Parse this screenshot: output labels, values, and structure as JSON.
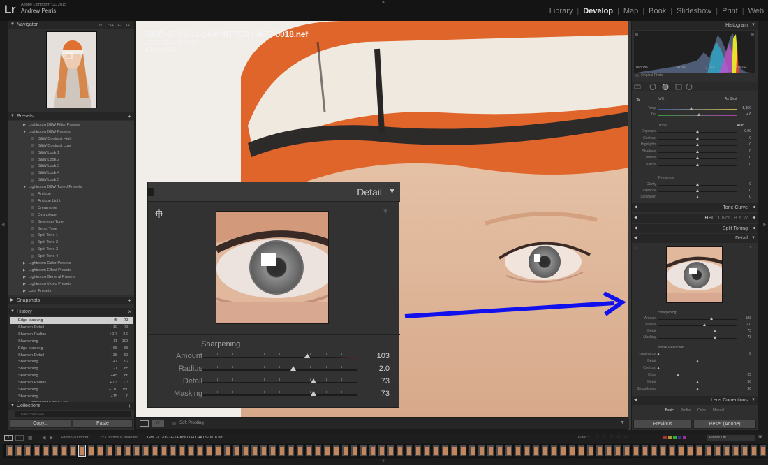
{
  "app": {
    "product": "Adobe Lightroom CC 2015",
    "user": "Andrew Perris",
    "logo": "Lr"
  },
  "modules": [
    {
      "label": "Library",
      "active": false
    },
    {
      "label": "Develop",
      "active": true
    },
    {
      "label": "Map",
      "active": false
    },
    {
      "label": "Book",
      "active": false
    },
    {
      "label": "Slideshow",
      "active": false
    },
    {
      "label": "Print",
      "active": false
    },
    {
      "label": "Web",
      "active": false
    }
  ],
  "navigator": {
    "title": "Navigator",
    "zoom_options": [
      "FIT",
      "FILL",
      "1:1",
      "3:1"
    ]
  },
  "presets": {
    "title": "Presets",
    "items": [
      {
        "label": "Lightroom B&W Filter Presets",
        "level": 1,
        "expanded": false
      },
      {
        "label": "Lightroom B&W Presets",
        "level": 1,
        "expanded": true
      },
      {
        "label": "B&W Contrast High",
        "level": 2
      },
      {
        "label": "B&W Contrast Low",
        "level": 2
      },
      {
        "label": "B&W Look 1",
        "level": 2
      },
      {
        "label": "B&W Look 2",
        "level": 2
      },
      {
        "label": "B&W Look 3",
        "level": 2
      },
      {
        "label": "B&W Look 4",
        "level": 2
      },
      {
        "label": "B&W Look 5",
        "level": 2
      },
      {
        "label": "Lightroom B&W Toned Presets",
        "level": 1,
        "expanded": true
      },
      {
        "label": "Antique",
        "level": 2
      },
      {
        "label": "Antique Light",
        "level": 2
      },
      {
        "label": "Creamtone",
        "level": 2
      },
      {
        "label": "Cyanotype",
        "level": 2
      },
      {
        "label": "Selenium Tone",
        "level": 2
      },
      {
        "label": "Sepia Tone",
        "level": 2
      },
      {
        "label": "Split Tone 1",
        "level": 2
      },
      {
        "label": "Split Tone 2",
        "level": 2
      },
      {
        "label": "Split Tone 3",
        "level": 2
      },
      {
        "label": "Split Tone 4",
        "level": 2
      },
      {
        "label": "Lightroom Color Presets",
        "level": 1,
        "expanded": false
      },
      {
        "label": "Lightroom Effect Presets",
        "level": 1,
        "expanded": false
      },
      {
        "label": "Lightroom General Presets",
        "level": 1,
        "expanded": false
      },
      {
        "label": "Lightroom Video Presets",
        "level": 1,
        "expanded": false
      },
      {
        "label": "User Presets",
        "level": 1,
        "expanded": false
      }
    ]
  },
  "snapshots": {
    "title": "Snapshots"
  },
  "history": {
    "title": "History",
    "items": [
      {
        "label": "Edge Masking",
        "delta": "+5",
        "value": "73",
        "selected": true
      },
      {
        "label": "Sharpen Detail",
        "delta": "+10",
        "value": "73"
      },
      {
        "label": "Sharpen Radius",
        "delta": "+0.7",
        "value": "2.0"
      },
      {
        "label": "Sharpening",
        "delta": "+11",
        "value": "103"
      },
      {
        "label": "Edge Masking",
        "delta": "+68",
        "value": "68"
      },
      {
        "label": "Sharpen Detail",
        "delta": "+38",
        "value": "63"
      },
      {
        "label": "Sharpening",
        "delta": "+7",
        "value": "92"
      },
      {
        "label": "Sharpening",
        "delta": "-1",
        "value": "85"
      },
      {
        "label": "Sharpening",
        "delta": "+45",
        "value": "86"
      },
      {
        "label": "Sharpen Radius",
        "delta": "+0.3",
        "value": "1.3"
      },
      {
        "label": "Sharpening",
        "delta": "+110",
        "value": "150"
      },
      {
        "label": "Sharpening",
        "delta": "+15",
        "value": "0"
      },
      {
        "label": "Import (27/07/2015 10:34:52)",
        "delta": "",
        "value": ""
      }
    ]
  },
  "collections": {
    "title": "Collections",
    "filter_placeholder": "Filter Collections"
  },
  "left_buttons": {
    "copy": "Copy...",
    "paste": "Paste"
  },
  "photo": {
    "filename": "GMC-17-06-14-14-KNITTED HATS-0018.nef",
    "datetime": "17/06/2014 16:50:51",
    "dimensions": "4912 x 7360"
  },
  "big_detail": {
    "title": "Detail",
    "section": "Sharpening",
    "sliders": [
      {
        "label": "Amount",
        "value": "103",
        "fraction": 0.68
      },
      {
        "label": "Radius",
        "value": "2.0",
        "fraction": 0.59
      },
      {
        "label": "Detail",
        "value": "73",
        "fraction": 0.72
      },
      {
        "label": "Masking",
        "value": "73",
        "fraction": 0.72
      }
    ]
  },
  "histogram": {
    "title": "Histogram",
    "iso": "ISO 100",
    "focal": "60 mm",
    "aperture": "ƒ / 5.6",
    "shutter": "1/125 sec",
    "original_photo": "Original Photo"
  },
  "basic": {
    "wb_label": "WB :",
    "wb_value": "As Shot",
    "temp": {
      "label": "Temp",
      "value": "5,350",
      "fraction": 0.42
    },
    "tint": {
      "label": "Tint",
      "value": "+ 6",
      "fraction": 0.52
    },
    "tone_label": "Tone",
    "auto_label": "Auto",
    "tone_sliders": [
      {
        "label": "Exposure",
        "value": "0.00",
        "fraction": 0.5
      },
      {
        "label": "Contrast",
        "value": "0",
        "fraction": 0.5
      },
      {
        "label": "Highlights",
        "value": "0",
        "fraction": 0.5
      },
      {
        "label": "Shadows",
        "value": "0",
        "fraction": 0.5
      },
      {
        "label": "Whites",
        "value": "0",
        "fraction": 0.5
      },
      {
        "label": "Blacks",
        "value": "0",
        "fraction": 0.5
      }
    ],
    "presence_label": "Presence",
    "presence_sliders": [
      {
        "label": "Clarity",
        "value": "0",
        "fraction": 0.5
      },
      {
        "label": "Vibrance",
        "value": "0",
        "fraction": 0.5
      },
      {
        "label": "Saturation",
        "value": "0",
        "fraction": 0.5
      }
    ]
  },
  "right_sections": {
    "tone_curve": "Tone Curve",
    "hsl": "HSL",
    "color": "Color",
    "bw": "B & W",
    "split_toning": "Split Toning",
    "detail": "Detail",
    "lens_corrections": "Lens Corrections"
  },
  "small_detail": {
    "sharpening_label": "Sharpening",
    "sharpening": [
      {
        "label": "Amount",
        "value": "103",
        "fraction": 0.68
      },
      {
        "label": "Radius",
        "value": "2.0",
        "fraction": 0.59
      },
      {
        "label": "Detail",
        "value": "73",
        "fraction": 0.72
      },
      {
        "label": "Masking",
        "value": "73",
        "fraction": 0.72
      }
    ],
    "noise_label": "Noise Reduction",
    "noise": [
      {
        "label": "Luminance",
        "value": "0",
        "fraction": 0.0
      },
      {
        "label": "Detail",
        "value": "",
        "fraction": 0.5
      },
      {
        "label": "Contrast",
        "value": "",
        "fraction": 0.0
      },
      {
        "label": "Color",
        "value": "25",
        "fraction": 0.25
      },
      {
        "label": "Detail",
        "value": "50",
        "fraction": 0.5
      },
      {
        "label": "Smoothness",
        "value": "50",
        "fraction": 0.5
      }
    ]
  },
  "lens_tabs": [
    "Basic",
    "Profile",
    "Color",
    "Manual"
  ],
  "right_buttons": {
    "previous": "Previous",
    "reset": "Reset (Adobe)"
  },
  "toolbar": {
    "soft_proofing": "Soft Proofing"
  },
  "filmbar": {
    "page1": "1",
    "page2": "2",
    "source": "Previous Import",
    "count": "223 photos /1 selected /",
    "selected_file": "GMC-17-06-14-14-KNITTED HATS-0018.nef",
    "filter_label": "Filter :",
    "filters_off": "Filters Off"
  },
  "colors": {
    "accent_arrow": "#1111ee",
    "panel": "#2f2f2f",
    "header": "#262626"
  }
}
